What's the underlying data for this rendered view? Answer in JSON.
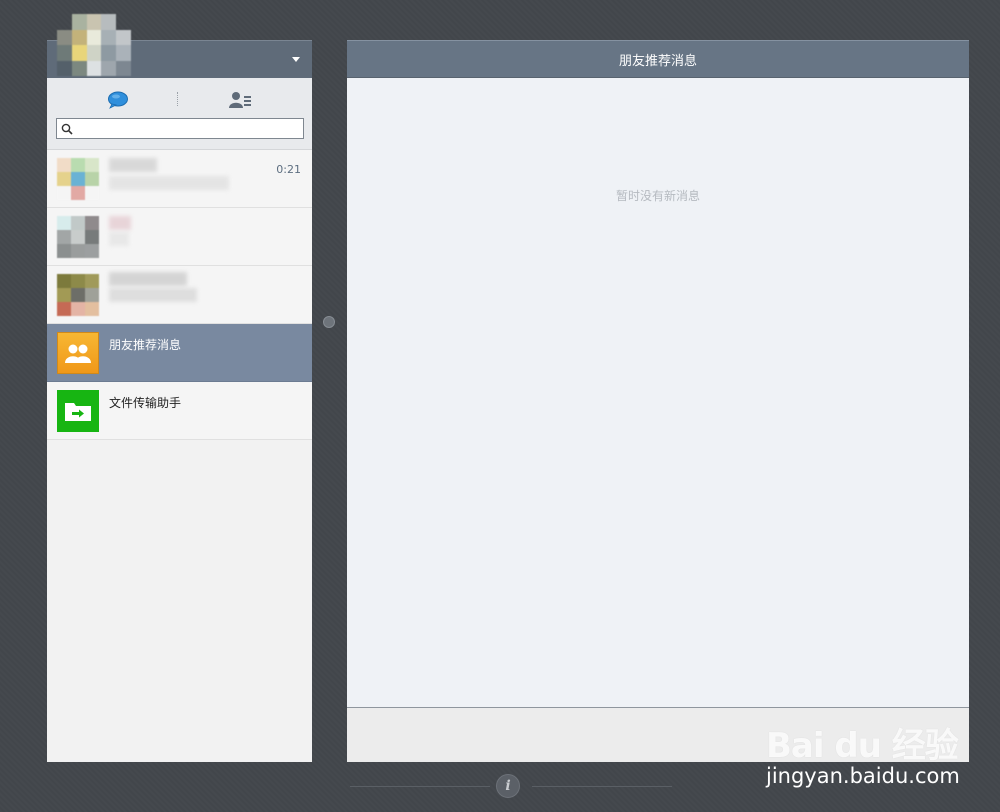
{
  "sidebar": {
    "tabs": [
      {
        "name": "chat",
        "icon": "chat-bubble-icon"
      },
      {
        "name": "contacts",
        "icon": "contacts-icon"
      }
    ],
    "search": {
      "placeholder": "",
      "value": ""
    },
    "conversations": [
      {
        "time": "0:21",
        "name": ""
      },
      {
        "time": "",
        "name": ""
      },
      {
        "time": "",
        "name": ""
      },
      {
        "time": "",
        "name": "朋友推荐消息",
        "selected": true
      },
      {
        "time": "",
        "name": "文件传输助手"
      }
    ]
  },
  "main": {
    "title": "朋友推荐消息",
    "empty_message": "暂时没有新消息"
  },
  "watermark": {
    "logo": "Bai du 经验",
    "url": "jingyan.baidu.com"
  },
  "colors": {
    "header": "#677585",
    "selected_row": "#7989a0",
    "background": "#43474c"
  }
}
